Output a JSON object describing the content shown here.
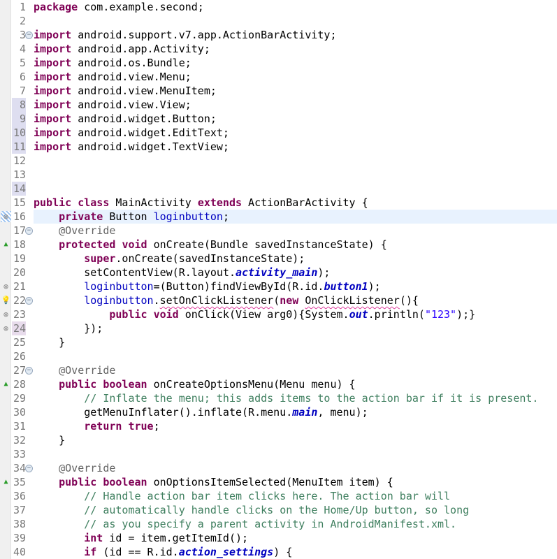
{
  "lines": [
    [
      [
        "k",
        "package"
      ],
      [
        "p",
        " com.example.second;"
      ]
    ],
    [],
    [
      [
        "k",
        "import"
      ],
      [
        "p",
        " android.support.v7.app.ActionBarActivity;"
      ]
    ],
    [
      [
        "k",
        "import"
      ],
      [
        "p",
        " android.app.Activity;"
      ]
    ],
    [
      [
        "k",
        "import"
      ],
      [
        "p",
        " android.os.Bundle;"
      ]
    ],
    [
      [
        "k",
        "import"
      ],
      [
        "p",
        " android.view.Menu;"
      ]
    ],
    [
      [
        "k",
        "import"
      ],
      [
        "p",
        " android.view.MenuItem;"
      ]
    ],
    [
      [
        "k",
        "import"
      ],
      [
        "p",
        " android.view.View;"
      ]
    ],
    [
      [
        "k",
        "import"
      ],
      [
        "p",
        " android.widget.Button;"
      ]
    ],
    [
      [
        "k",
        "import"
      ],
      [
        "p",
        " android.widget.EditText;"
      ]
    ],
    [
      [
        "k",
        "import"
      ],
      [
        "p",
        " android.widget.TextView;"
      ]
    ],
    [],
    [],
    [],
    [
      [
        "k",
        "public"
      ],
      [
        "p",
        " "
      ],
      [
        "k",
        "class"
      ],
      [
        "p",
        " MainActivity "
      ],
      [
        "k",
        "extends"
      ],
      [
        "p",
        " ActionBarActivity {"
      ]
    ],
    [
      [
        "p",
        "    "
      ],
      [
        "k",
        "private"
      ],
      [
        "p",
        " Button "
      ],
      [
        "f",
        "loginbutton"
      ],
      [
        "p",
        ";"
      ]
    ],
    [
      [
        "p",
        "    "
      ],
      [
        "a",
        "@Override"
      ]
    ],
    [
      [
        "p",
        "    "
      ],
      [
        "k",
        "protected"
      ],
      [
        "p",
        " "
      ],
      [
        "k",
        "void"
      ],
      [
        "p",
        " onCreate(Bundle savedInstanceState) {"
      ]
    ],
    [
      [
        "p",
        "        "
      ],
      [
        "k",
        "super"
      ],
      [
        "p",
        ".onCreate(savedInstanceState);"
      ]
    ],
    [
      [
        "p",
        "        setContentView(R.layout."
      ],
      [
        "fi",
        "activity_main"
      ],
      [
        "p",
        ");"
      ]
    ],
    [
      [
        "p",
        "        "
      ],
      [
        "f",
        "loginbutton"
      ],
      [
        "p",
        "=(Button)findViewById(R.id."
      ],
      [
        "fi",
        "button1"
      ],
      [
        "p",
        ");"
      ]
    ],
    [
      [
        "p",
        "        "
      ],
      [
        "f",
        "loginbutton"
      ],
      [
        "p",
        "."
      ],
      [
        "u",
        "setOnClickListener"
      ],
      [
        "p",
        "("
      ],
      [
        "k",
        "new"
      ],
      [
        "p",
        " "
      ],
      [
        "u",
        "OnClickListener"
      ],
      [
        "p",
        "(){"
      ]
    ],
    [
      [
        "p",
        "            "
      ],
      [
        "k",
        "public"
      ],
      [
        "p",
        " "
      ],
      [
        "k",
        "void"
      ],
      [
        "p",
        " onClick(View arg0){System."
      ],
      [
        "fi",
        "out"
      ],
      [
        "p",
        ".println("
      ],
      [
        "s",
        "\"123\""
      ],
      [
        "p",
        ");}"
      ]
    ],
    [
      [
        "p",
        "        });"
      ]
    ],
    [
      [
        "p",
        "    }"
      ]
    ],
    [],
    [
      [
        "p",
        "    "
      ],
      [
        "a",
        "@Override"
      ]
    ],
    [
      [
        "p",
        "    "
      ],
      [
        "k",
        "public"
      ],
      [
        "p",
        " "
      ],
      [
        "k",
        "boolean"
      ],
      [
        "p",
        " onCreateOptionsMenu(Menu menu) {"
      ]
    ],
    [
      [
        "p",
        "        "
      ],
      [
        "c",
        "// Inflate the menu; this adds items to the action bar if it is present."
      ]
    ],
    [
      [
        "p",
        "        getMenuInflater().inflate(R.menu."
      ],
      [
        "fi",
        "main"
      ],
      [
        "p",
        ", menu);"
      ]
    ],
    [
      [
        "p",
        "        "
      ],
      [
        "k",
        "return"
      ],
      [
        "p",
        " "
      ],
      [
        "k",
        "true"
      ],
      [
        "p",
        ";"
      ]
    ],
    [
      [
        "p",
        "    }"
      ]
    ],
    [],
    [
      [
        "p",
        "    "
      ],
      [
        "a",
        "@Override"
      ]
    ],
    [
      [
        "p",
        "    "
      ],
      [
        "k",
        "public"
      ],
      [
        "p",
        " "
      ],
      [
        "k",
        "boolean"
      ],
      [
        "p",
        " onOptionsItemSelected(MenuItem item) {"
      ]
    ],
    [
      [
        "p",
        "        "
      ],
      [
        "c",
        "// Handle action bar item clicks here. The action bar will"
      ]
    ],
    [
      [
        "p",
        "        "
      ],
      [
        "c",
        "// automatically handle clicks on the Home/Up button, so long"
      ]
    ],
    [
      [
        "p",
        "        "
      ],
      [
        "c",
        "// as you specify a parent activity in AndroidManifest.xml."
      ]
    ],
    [
      [
        "p",
        "        "
      ],
      [
        "k",
        "int"
      ],
      [
        "p",
        " id = item.getItemId();"
      ]
    ],
    [
      [
        "p",
        "        "
      ],
      [
        "k",
        "if"
      ],
      [
        "p",
        " (id == R.id."
      ],
      [
        "fi",
        "action_settings"
      ],
      [
        "p",
        ") {"
      ]
    ]
  ],
  "current_line": 16,
  "fold_lines": [
    3,
    17,
    22,
    27,
    34
  ],
  "override_lines": [
    18,
    28,
    35
  ],
  "error_lines": [
    16,
    21,
    23,
    24
  ],
  "quickfix_lines": [
    22
  ],
  "highlighted_numbers": [
    8,
    9,
    10,
    11,
    14
  ],
  "highlighted_numbers_alt": [
    24
  ]
}
